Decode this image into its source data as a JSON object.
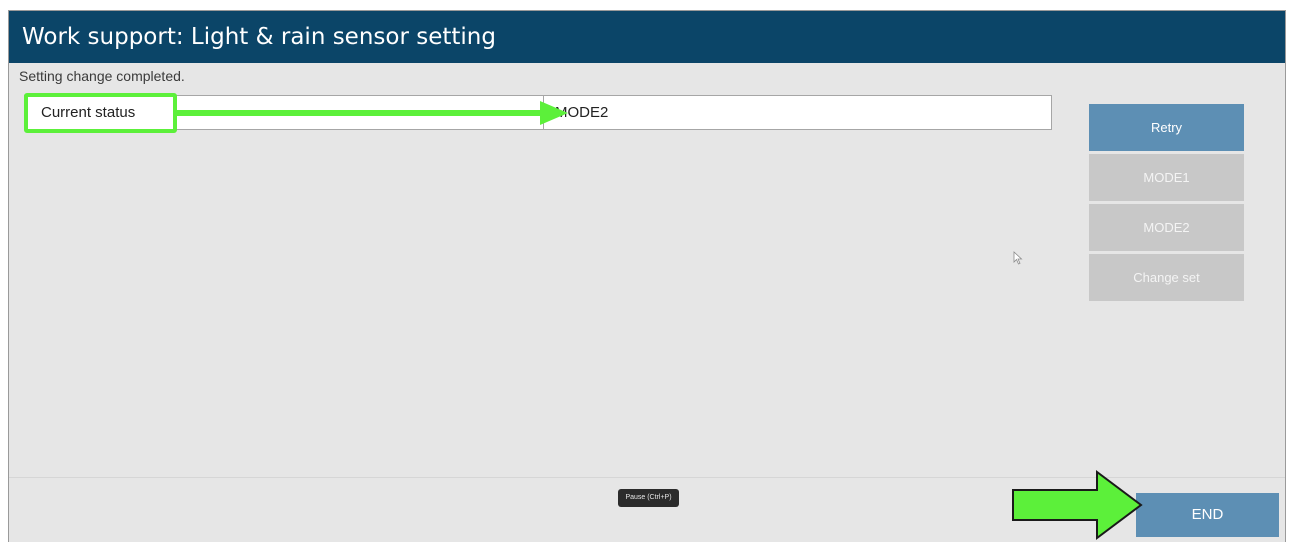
{
  "window": {
    "title": "Work support: Light & rain sensor setting"
  },
  "status": {
    "message": "Setting change completed."
  },
  "current_status": {
    "label": "Current status",
    "value": "MODE2"
  },
  "side_buttons": {
    "retry": "Retry",
    "mode1": "MODE1",
    "mode2": "MODE2",
    "change_set": "Change set"
  },
  "footer": {
    "pause_label": "Pause (Ctrl+P)",
    "end_label": "END"
  },
  "colors": {
    "title_bar": "#0b4568",
    "button_active": "#5d8fb4",
    "button_disabled": "#c8c8c8",
    "highlight_green": "#5cf03a"
  },
  "icons": {
    "cursor": "mouse-pointer-icon",
    "annotation_arrow": "arrow-right-icon"
  }
}
